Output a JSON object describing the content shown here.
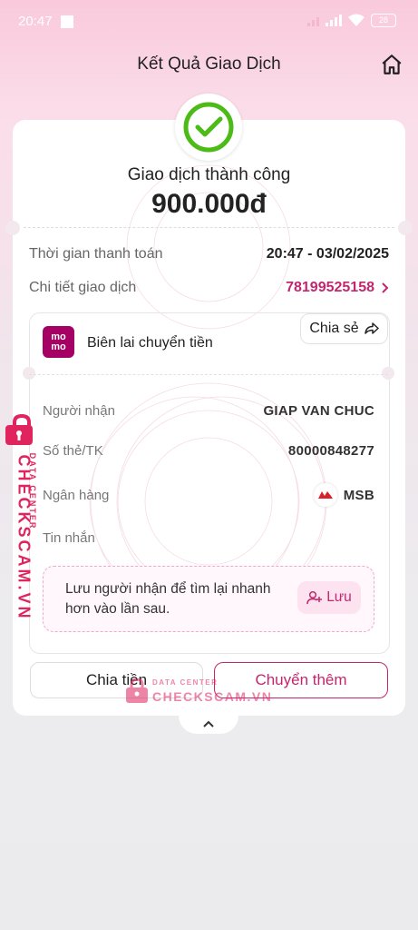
{
  "status_bar": {
    "time": "20:47",
    "battery": "28"
  },
  "header": {
    "title": "Kết Quả Giao Dịch"
  },
  "result": {
    "status": "Giao dịch thành công",
    "amount": "900.000đ"
  },
  "summary": {
    "time_label": "Thời gian thanh toán",
    "time_value": "20:47 - 03/02/2025",
    "detail_label": "Chi tiết giao dịch",
    "detail_value": "78199525158"
  },
  "receipt": {
    "logo_line1": "mo",
    "logo_line2": "mo",
    "title": "Biên lai chuyển tiền",
    "share_label": "Chia sẻ",
    "recipient_label": "Người nhận",
    "recipient_value": "GIAP VAN CHUC",
    "account_label": "Số thẻ/TK",
    "account_value": "80000848277",
    "bank_label": "Ngân hàng",
    "bank_value": "MSB",
    "message_label": "Tin nhắn",
    "save_hint": "Lưu người nhận để tìm lại nhanh hơn vào lần sau.",
    "save_label": "Lưu"
  },
  "actions": {
    "split_label": "Chia tiền",
    "transfer_more_label": "Chuyển thêm"
  },
  "watermark": {
    "brand": "CHECKSCAM.VN",
    "sub": "DATA CENTER"
  },
  "colors": {
    "accent": "#c2266f",
    "momo": "#a50064",
    "success": "#4cbb17"
  }
}
